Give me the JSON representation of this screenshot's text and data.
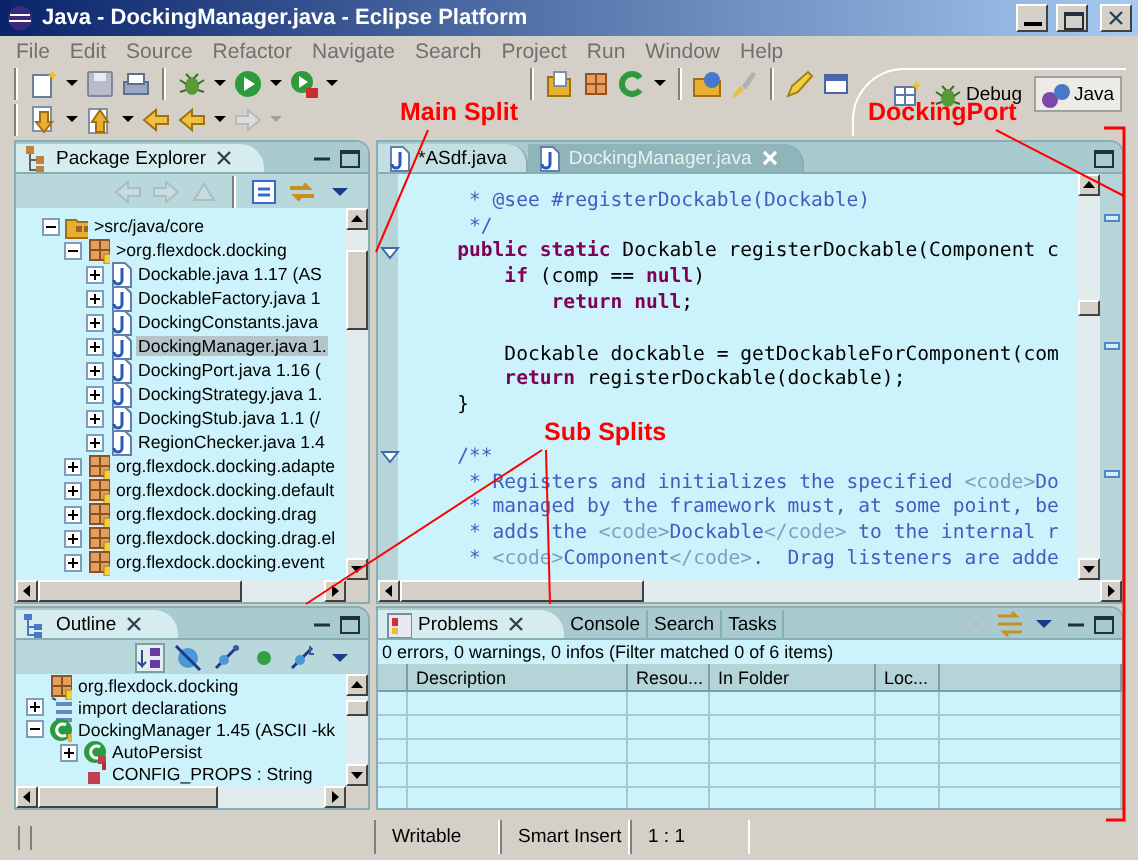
{
  "window": {
    "title": "Java - DockingManager.java - Eclipse Platform"
  },
  "menu": [
    "File",
    "Edit",
    "Source",
    "Refactor",
    "Navigate",
    "Search",
    "Project",
    "Run",
    "Window",
    "Help"
  ],
  "perspectives": [
    {
      "label": "Debug",
      "selected": false
    },
    {
      "label": "Java",
      "selected": true
    }
  ],
  "package_explorer": {
    "title": "Package Explorer",
    "tree": [
      {
        "label": ">src/java/core",
        "kind": "folder",
        "expanded": true,
        "selected": false,
        "children": [
          {
            "label": ">org.flexdock.docking",
            "kind": "package",
            "expanded": true,
            "selected": false,
            "children": [
              {
                "label": "Dockable.java 1.17 (AS",
                "kind": "file",
                "expanded": false,
                "selected": false
              },
              {
                "label": "DockableFactory.java 1",
                "kind": "file",
                "expanded": false,
                "selected": false
              },
              {
                "label": "DockingConstants.java",
                "kind": "file",
                "expanded": false,
                "selected": false
              },
              {
                "label": "DockingManager.java 1.",
                "kind": "file",
                "expanded": false,
                "selected": true
              },
              {
                "label": "DockingPort.java 1.16 (",
                "kind": "file",
                "expanded": false,
                "selected": false
              },
              {
                "label": "DockingStrategy.java 1.",
                "kind": "file",
                "expanded": false,
                "selected": false
              },
              {
                "label": "DockingStub.java 1.1 (/",
                "kind": "file",
                "expanded": false,
                "selected": false
              },
              {
                "label": "RegionChecker.java 1.4",
                "kind": "file",
                "expanded": false,
                "selected": false
              }
            ]
          },
          {
            "label": "org.flexdock.docking.adapte",
            "kind": "package",
            "expanded": false,
            "selected": false
          },
          {
            "label": "org.flexdock.docking.default",
            "kind": "package",
            "expanded": false,
            "selected": false
          },
          {
            "label": "org.flexdock.docking.drag",
            "kind": "package",
            "expanded": false,
            "selected": false
          },
          {
            "label": "org.flexdock.docking.drag.el",
            "kind": "package",
            "expanded": false,
            "selected": false
          },
          {
            "label": "org.flexdock.docking.event",
            "kind": "package",
            "expanded": false,
            "selected": false
          }
        ]
      }
    ]
  },
  "editor": {
    "tabs": [
      {
        "label": "*ASdf.java",
        "selected": false
      },
      {
        "label": "DockingManager.java",
        "selected": true
      }
    ],
    "lines": [
      {
        "segments": [
          {
            "kind": "comment",
            "text": "     * @see #registerDockable(Dockable)"
          }
        ]
      },
      {
        "segments": [
          {
            "kind": "comment",
            "text": "     */"
          }
        ]
      },
      {
        "fold": true,
        "segments": [
          {
            "kind": "keyword",
            "text": "    public"
          },
          {
            "kind": "keyword",
            "text": " static"
          },
          {
            "kind": "plain",
            "text": " Dockable registerDockable(Component c"
          }
        ]
      },
      {
        "segments": [
          {
            "kind": "keyword",
            "text": "        if"
          },
          {
            "kind": "plain",
            "text": " (comp == "
          },
          {
            "kind": "keyword",
            "text": "null"
          },
          {
            "kind": "plain",
            "text": ")"
          }
        ]
      },
      {
        "segments": [
          {
            "kind": "keyword",
            "text": "            return"
          },
          {
            "kind": "keyword",
            "text": " null"
          },
          {
            "kind": "plain",
            "text": ";"
          }
        ]
      },
      {
        "blank_before": true,
        "segments": [
          {
            "kind": "plain",
            "text": "        Dockable dockable = getDockableForComponent(com"
          }
        ]
      },
      {
        "segments": [
          {
            "kind": "keyword",
            "text": "        return"
          },
          {
            "kind": "plain",
            "text": " registerDockable(dockable);"
          }
        ]
      },
      {
        "segments": [
          {
            "kind": "plain",
            "text": "    }"
          }
        ]
      },
      {
        "blank_before": true,
        "fold": true,
        "segments": [
          {
            "kind": "comment",
            "text": "    /**"
          }
        ]
      },
      {
        "segments": [
          {
            "kind": "comment",
            "text": "     * Registers and initializes the specified "
          },
          {
            "kind": "tag",
            "text": "<code>"
          },
          {
            "kind": "comment",
            "text": "Do"
          }
        ]
      },
      {
        "segments": [
          {
            "kind": "comment",
            "text": "     * managed by the framework must, at some point, be"
          }
        ]
      },
      {
        "segments": [
          {
            "kind": "comment",
            "text": "     * adds the "
          },
          {
            "kind": "tag",
            "text": "<code>"
          },
          {
            "kind": "comment",
            "text": "Dockable"
          },
          {
            "kind": "tag",
            "text": "</code>"
          },
          {
            "kind": "comment",
            "text": " to the internal r"
          }
        ]
      },
      {
        "segments": [
          {
            "kind": "comment",
            "text": "     * "
          },
          {
            "kind": "tag",
            "text": "<code>"
          },
          {
            "kind": "comment",
            "text": "Component"
          },
          {
            "kind": "tag",
            "text": "</code>"
          },
          {
            "kind": "comment",
            "text": ".  Drag listeners are adde"
          }
        ]
      }
    ]
  },
  "outline": {
    "title": "Outline",
    "tree": [
      {
        "label": "org.flexdock.docking",
        "kind": "package",
        "selected": false
      },
      {
        "label": "import declarations",
        "kind": "imports",
        "expanded": false,
        "selected": false
      },
      {
        "label": "DockingManager 1.45 (ASCII -kk",
        "kind": "class",
        "expanded": true,
        "selected": false,
        "children": [
          {
            "label": "AutoPersist",
            "kind": "inner",
            "expanded": false,
            "selected": false
          },
          {
            "label": "CONFIG_PROPS : String",
            "kind": "field",
            "selected": false
          }
        ]
      }
    ]
  },
  "problems": {
    "tabs": [
      {
        "label": "Problems",
        "selected": true
      },
      {
        "label": "Console",
        "selected": false
      },
      {
        "label": "Search",
        "selected": false
      },
      {
        "label": "Tasks",
        "selected": false
      }
    ],
    "summary": "0 errors, 0 warnings, 0 infos (Filter matched 0 of 6 items)",
    "columns": [
      "Description",
      "Resou...",
      "In Folder",
      "Loc..."
    ]
  },
  "status_bar": [
    "Writable",
    "Smart Insert",
    "1 : 1"
  ],
  "annotations": [
    {
      "label": "Main Split"
    },
    {
      "label": "DockingPort"
    },
    {
      "label": "Sub Splits"
    }
  ]
}
